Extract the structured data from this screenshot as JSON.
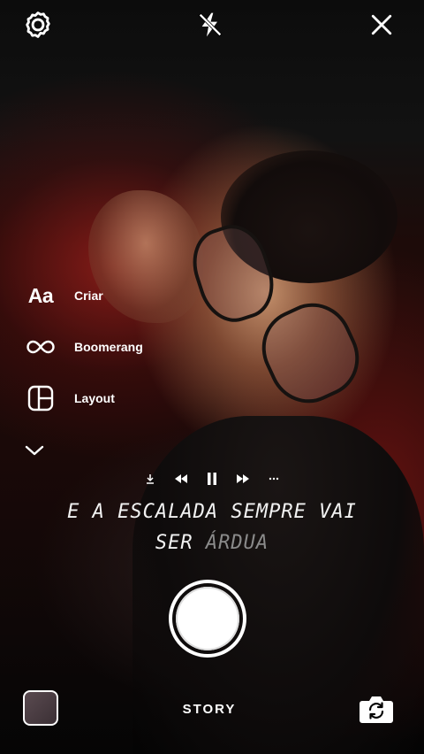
{
  "top_bar": {
    "settings_icon": "gear-icon",
    "flash_icon": "flash-off-icon",
    "close_icon": "close-icon"
  },
  "side_menu": {
    "items": [
      {
        "icon": "text-aa-icon",
        "icon_text": "Aa",
        "label": "Criar"
      },
      {
        "icon": "infinity-icon",
        "label": "Boomerang"
      },
      {
        "icon": "layout-grid-icon",
        "label": "Layout"
      }
    ],
    "more_icon": "chevron-down-icon"
  },
  "music_player": {
    "controls": [
      "download-icon",
      "rewind-icon",
      "pause-icon",
      "fast-forward-icon",
      "more-icon"
    ],
    "lyric_line_1": "E A ESCALADA SEMPRE VAI",
    "lyric_line_2_main": "SER",
    "lyric_line_2_dim": "ÁRDUA"
  },
  "bottom_bar": {
    "mode_label": "STORY",
    "gallery_icon": "gallery-thumbnail",
    "flip_icon": "camera-flip-icon"
  },
  "colors": {
    "text": "#ffffff",
    "dim_lyric": "#8a8a8a"
  }
}
